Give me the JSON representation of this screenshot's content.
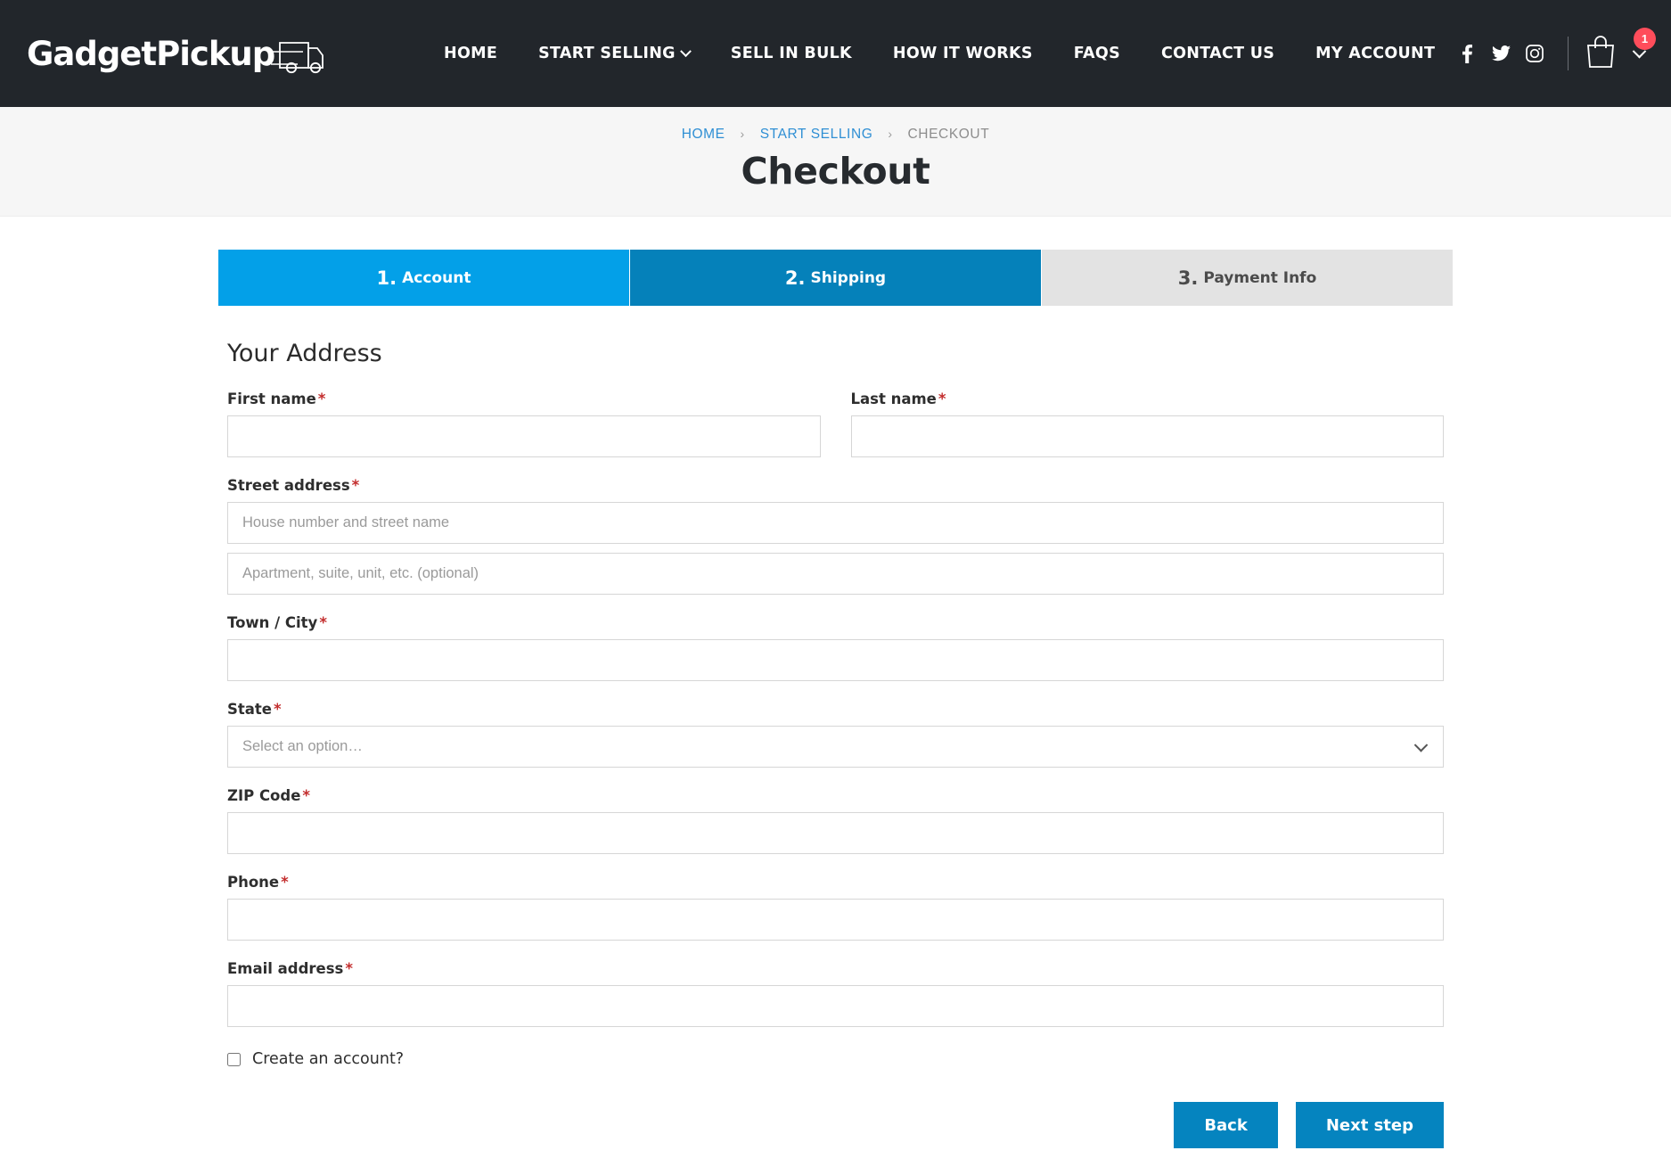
{
  "header": {
    "logo_text": "GadgetPickup",
    "logo_icon": "truck-icon",
    "nav": [
      {
        "label": "HOME",
        "has_caret": false
      },
      {
        "label": "START SELLING",
        "has_caret": true
      },
      {
        "label": "SELL IN BULK",
        "has_caret": false
      },
      {
        "label": "HOW IT WORKS",
        "has_caret": false
      },
      {
        "label": "FAQS",
        "has_caret": false
      },
      {
        "label": "CONTACT US",
        "has_caret": false
      },
      {
        "label": "MY ACCOUNT",
        "has_caret": false
      }
    ],
    "social": [
      {
        "name": "facebook-icon",
        "glyph": "f"
      },
      {
        "name": "twitter-icon",
        "glyph": ""
      },
      {
        "name": "instagram-icon",
        "glyph": ""
      }
    ],
    "cart": {
      "count": "1"
    },
    "background_color": "#22262b"
  },
  "titlebar": {
    "breadcrumb": [
      {
        "label": "HOME",
        "link": true
      },
      {
        "label": "START SELLING",
        "link": true
      },
      {
        "label": "CHECKOUT",
        "link": false
      }
    ],
    "separator": "›",
    "title": "Checkout"
  },
  "steps": [
    {
      "num": "1.",
      "label": "Account",
      "state": "complete",
      "color": "#03a0e8"
    },
    {
      "num": "2.",
      "label": "Shipping",
      "state": "active",
      "color": "#0581ba"
    },
    {
      "num": "3.",
      "label": "Payment Info",
      "state": "upcoming",
      "color": "#e3e3e3"
    }
  ],
  "form": {
    "section_title": "Your Address",
    "required_marker": "*",
    "fields": {
      "first_name": {
        "label": "First name",
        "value": "",
        "placeholder": ""
      },
      "last_name": {
        "label": "Last name",
        "value": "",
        "placeholder": ""
      },
      "street_address": {
        "label": "Street address",
        "value": "",
        "placeholder": "House number and street name"
      },
      "street_address_2": {
        "label": "",
        "value": "",
        "placeholder": "Apartment, suite, unit, etc. (optional)"
      },
      "town_city": {
        "label": "Town / City",
        "value": "",
        "placeholder": ""
      },
      "state": {
        "label": "State",
        "value": "Select an option…",
        "placeholder": "Select an option…"
      },
      "zip_code": {
        "label": "ZIP Code",
        "value": "",
        "placeholder": ""
      },
      "phone": {
        "label": "Phone",
        "value": "",
        "placeholder": ""
      },
      "email": {
        "label": "Email address",
        "value": "",
        "placeholder": ""
      }
    },
    "create_account": {
      "label": "Create an account?",
      "checked": false
    }
  },
  "actions": {
    "back_label": "Back",
    "next_label": "Next step",
    "button_color": "#0584bf"
  }
}
